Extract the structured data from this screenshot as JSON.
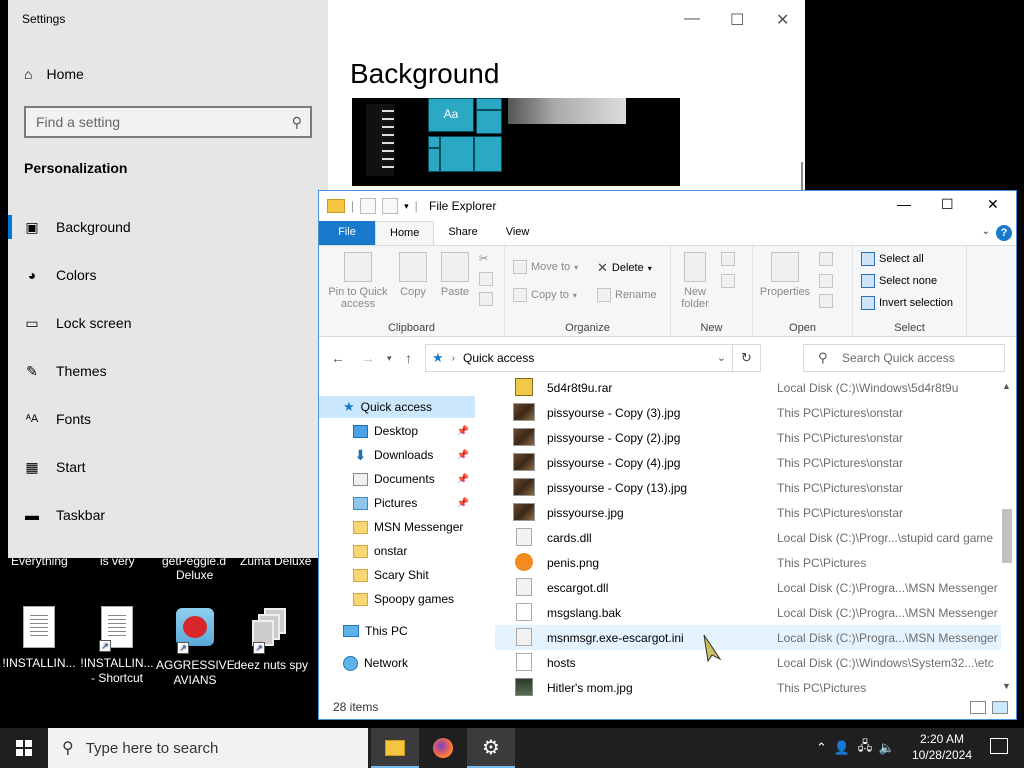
{
  "desktop": {
    "partial_labels": [
      "Everything",
      "is very",
      "getPeggle.d",
      "Deluxe",
      "Zuma Deluxe"
    ],
    "icons": [
      {
        "label1": "!INSTALLIN...",
        "label2": ""
      },
      {
        "label1": "!INSTALLIN...",
        "label2": "- Shortcut"
      },
      {
        "label1": "AGGRESSIVE",
        "label2": "AVIANS"
      },
      {
        "label1": "deez nuts spy",
        "label2": ""
      }
    ]
  },
  "settings": {
    "window_title": "Settings",
    "home": "Home",
    "search_placeholder": "Find a setting",
    "section": "Personalization",
    "items": [
      "Background",
      "Colors",
      "Lock screen",
      "Themes",
      "Fonts",
      "Start",
      "Taskbar"
    ],
    "page_title": "Background",
    "preview_tile_label": "Aa"
  },
  "explorer": {
    "title": "File Explorer",
    "tabs": [
      "File",
      "Home",
      "Share",
      "View"
    ],
    "ribbon": {
      "pin": [
        "Pin to Quick",
        "access"
      ],
      "copy": "Copy",
      "paste": "Paste",
      "move_to": "Move to",
      "copy_to": "Copy to",
      "delete": "Delete",
      "rename": "Rename",
      "new_folder": [
        "New",
        "folder"
      ],
      "properties": "Properties",
      "select_all": "Select all",
      "select_none": "Select none",
      "invert_selection": "Invert selection",
      "groups": [
        "Clipboard",
        "Organize",
        "New",
        "Open",
        "Select"
      ]
    },
    "address": "Quick access",
    "search_placeholder": "Search Quick access",
    "nav": {
      "quick_access": "Quick access",
      "pinned": [
        "Desktop",
        "Downloads",
        "Documents",
        "Pictures"
      ],
      "folders": [
        "MSN Messenger",
        "onstar",
        "Scary Shit",
        "Spoopy games"
      ],
      "this_pc": "This PC",
      "network": "Network"
    },
    "files": [
      {
        "name": "5d4r8t9u.rar",
        "loc": "Local Disk (C:)\\Windows\\5d4r8t9u",
        "kind": "rar"
      },
      {
        "name": "pissyourse - Copy (3).jpg",
        "loc": "This PC\\Pictures\\onstar",
        "kind": "img"
      },
      {
        "name": "pissyourse - Copy (2).jpg",
        "loc": "This PC\\Pictures\\onstar",
        "kind": "img"
      },
      {
        "name": "pissyourse - Copy (4).jpg",
        "loc": "This PC\\Pictures\\onstar",
        "kind": "img"
      },
      {
        "name": "pissyourse - Copy (13).jpg",
        "loc": "This PC\\Pictures\\onstar",
        "kind": "img"
      },
      {
        "name": "pissyourse.jpg",
        "loc": "This PC\\Pictures\\onstar",
        "kind": "img"
      },
      {
        "name": "cards.dll",
        "loc": "Local Disk (C:)\\Progr...\\stupid card game",
        "kind": "dll"
      },
      {
        "name": "penis.png",
        "loc": "This PC\\Pictures",
        "kind": "png"
      },
      {
        "name": "escargot.dll",
        "loc": "Local Disk (C:)\\Progra...\\MSN Messenger",
        "kind": "dll"
      },
      {
        "name": "msgslang.bak",
        "loc": "Local Disk (C:)\\Progra...\\MSN Messenger",
        "kind": "gen"
      },
      {
        "name": "msnmsgr.exe-escargot.ini",
        "loc": "Local Disk (C:)\\Progra...\\MSN Messenger",
        "kind": "dll"
      },
      {
        "name": "hosts",
        "loc": "Local Disk (C:)\\Windows\\System32...\\etc",
        "kind": "gen"
      },
      {
        "name": "Hitler's mom.jpg",
        "loc": "This PC\\Pictures",
        "kind": "dark"
      }
    ],
    "status": "28 items"
  },
  "taskbar": {
    "search_placeholder": "Type here to search",
    "time": "2:20 AM",
    "date": "10/28/2024"
  }
}
